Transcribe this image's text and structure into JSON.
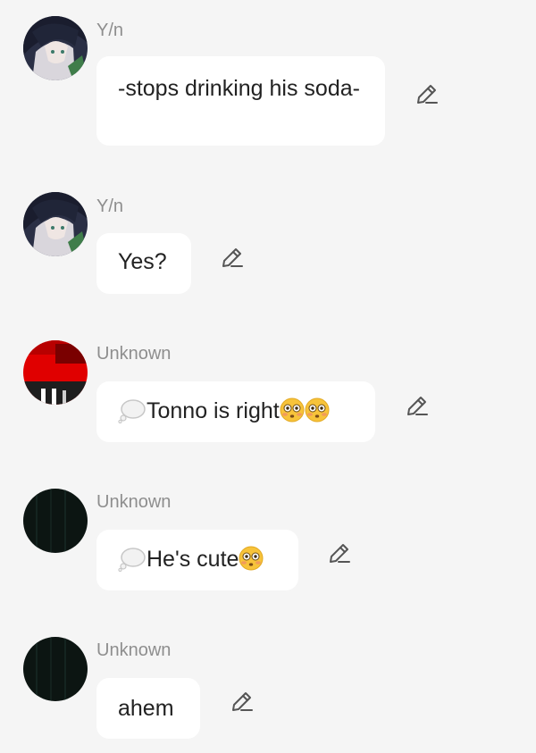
{
  "messages": [
    {
      "sender": "Y/n",
      "text": "-stops drinking his soda-",
      "avatar": "anime-boy-avatar",
      "edit_icon": "pencil-icon"
    },
    {
      "sender": "Y/n",
      "text": "Yes?",
      "avatar": "anime-boy-avatar",
      "edit_icon": "pencil-icon"
    },
    {
      "sender": "Unknown",
      "text": "Tonno is right",
      "prefix_icon": "thought-bubble-icon",
      "suffix_icons": [
        "flushed-face-emoji",
        "flushed-face-emoji"
      ],
      "avatar": "red-black-avatar",
      "edit_icon": "pencil-icon"
    },
    {
      "sender": "Unknown",
      "text": "He's cute",
      "prefix_icon": "thought-bubble-icon",
      "suffix_icons": [
        "flushed-face-emoji"
      ],
      "avatar": "dark-avatar",
      "edit_icon": "pencil-icon"
    },
    {
      "sender": "Unknown",
      "text": "ahem",
      "avatar": "dark-avatar",
      "edit_icon": "pencil-icon"
    }
  ],
  "colors": {
    "background": "#f5f5f5",
    "bubble": "#ffffff",
    "sender": "#8e8e8e",
    "text": "#222222",
    "emoji_face": "#f7c33a"
  }
}
